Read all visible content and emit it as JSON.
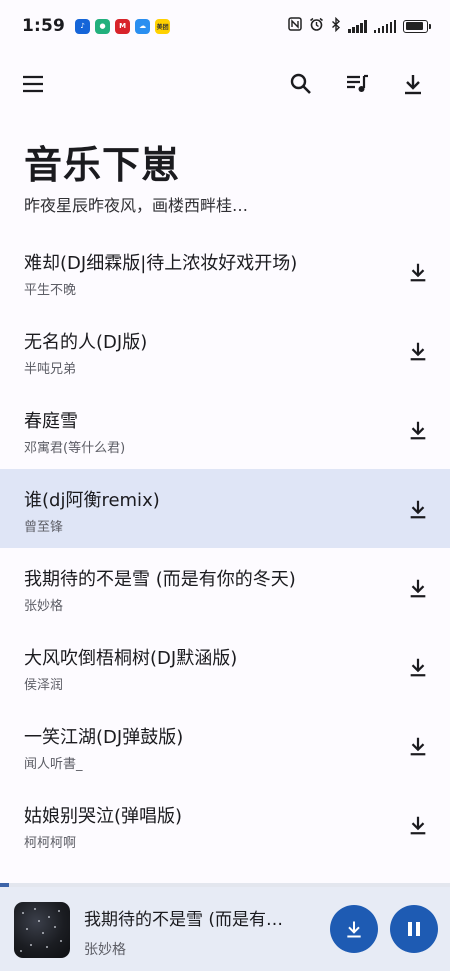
{
  "status_bar": {
    "time": "1:59",
    "apps": [
      {
        "name": "music-app-icon",
        "color": "#1565d8",
        "glyph": "♪"
      },
      {
        "name": "green-app-icon",
        "color": "#22b07d",
        "glyph": "●"
      },
      {
        "name": "mcdonalds-app-icon",
        "color": "#d8232a",
        "glyph": "M"
      },
      {
        "name": "cloud-app-icon",
        "color": "#2a8ff0",
        "glyph": "☁"
      },
      {
        "name": "meituan-app-icon",
        "color": "#ffd100",
        "glyph": "美团"
      }
    ],
    "icons": [
      "nfc-icon",
      "alarm-icon",
      "bluetooth-icon",
      "signal-icon",
      "wifi-icon",
      "battery-icon"
    ]
  },
  "toolbar": {
    "menu_icon": "menu-icon",
    "search_icon": "search-icon",
    "playlist_icon": "queue-music-icon",
    "download_icon": "download-icon"
  },
  "header": {
    "title": "音乐下崽",
    "subtitle": "昨夜星辰昨夜风，画楼西畔桂…"
  },
  "songs": [
    {
      "title": "难却(DJ细霖版|待上浓妆好戏开场)",
      "artist": "平生不晚",
      "active": false
    },
    {
      "title": "无名的人(DJ版)",
      "artist": "半吨兄弟",
      "active": false
    },
    {
      "title": "春庭雪",
      "artist": "邓寓君(等什么君)",
      "active": false
    },
    {
      "title": "谁(dj阿衡remix)",
      "artist": "曾至锋",
      "active": true
    },
    {
      "title": "我期待的不是雪 (而是有你的冬天)",
      "artist": "张妙格",
      "active": false
    },
    {
      "title": "大风吹倒梧桐树(DJ默涵版)",
      "artist": "侯泽润",
      "active": false
    },
    {
      "title": "一笑江湖(DJ弹鼓版)",
      "artist": "闻人听書_",
      "active": false
    },
    {
      "title": "姑娘别哭泣(弹唱版)",
      "artist": "柯柯柯啊",
      "active": false
    }
  ],
  "player": {
    "title": "我期待的不是雪 (而是有…",
    "artist": "张妙格",
    "progress": 0.02,
    "colors": {
      "accent": "#1e5bb3",
      "active_row": "#dfe5f6",
      "player_bg": "#e7ebf5"
    }
  }
}
